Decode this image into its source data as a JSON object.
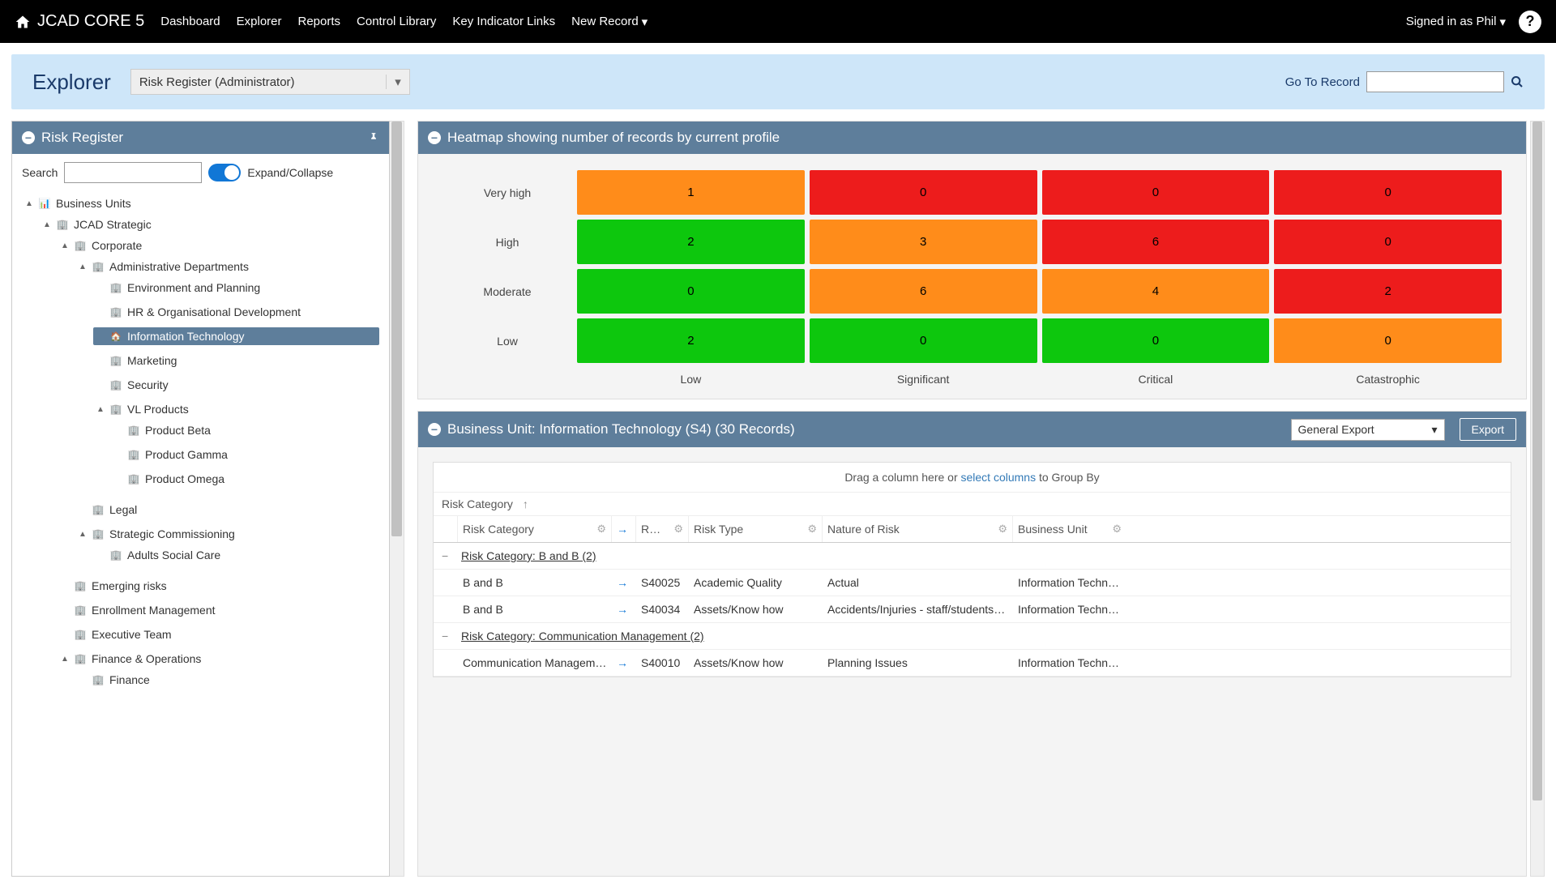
{
  "nav": {
    "brand": "JCAD CORE 5",
    "links": [
      "Dashboard",
      "Explorer",
      "Reports",
      "Control Library",
      "Key Indicator Links",
      "New Record"
    ],
    "signed_in": "Signed in as Phil"
  },
  "explorer_bar": {
    "title": "Explorer",
    "view_select": "Risk Register (Administrator)",
    "goto_label": "Go To Record"
  },
  "tree_panel": {
    "title": "Risk Register",
    "search_label": "Search",
    "expand_label": "Expand/Collapse",
    "tree": {
      "root": "Business Units",
      "l1": "JCAD Strategic",
      "l2": "Corporate",
      "l3": "Administrative Departments",
      "items_admin": [
        "Environment and Planning",
        "HR & Organisational Development",
        "Information Technology",
        "Marketing",
        "Security"
      ],
      "vl": "VL Products",
      "vl_items": [
        "Product Beta",
        "Product Gamma",
        "Product Omega"
      ],
      "corp_siblings_legal": "Legal",
      "strategic_comm": "Strategic Commissioning",
      "strategic_comm_items": [
        "Adults Social Care"
      ],
      "jcad_siblings": [
        "Emerging risks",
        "Enrollment Management",
        "Executive Team"
      ],
      "fin_ops": "Finance & Operations",
      "fin_ops_items": [
        "Finance"
      ]
    }
  },
  "heatmap": {
    "title": "Heatmap showing number of records by current profile",
    "row_labels": [
      "Very high",
      "High",
      "Moderate",
      "Low"
    ],
    "col_labels": [
      "Low",
      "Significant",
      "Critical",
      "Catastrophic"
    ]
  },
  "chart_data": {
    "type": "heatmap",
    "title": "Heatmap showing number of records by current profile",
    "y_categories": [
      "Very high",
      "High",
      "Moderate",
      "Low"
    ],
    "x_categories": [
      "Low",
      "Significant",
      "Critical",
      "Catastrophic"
    ],
    "values": [
      [
        1,
        0,
        0,
        0
      ],
      [
        2,
        3,
        6,
        0
      ],
      [
        0,
        6,
        4,
        2
      ],
      [
        2,
        0,
        0,
        0
      ]
    ],
    "colors": [
      [
        "orange",
        "red",
        "red",
        "red"
      ],
      [
        "green",
        "orange",
        "red",
        "red"
      ],
      [
        "green",
        "orange",
        "orange",
        "red"
      ],
      [
        "green",
        "green",
        "green",
        "orange"
      ]
    ]
  },
  "records": {
    "title": "Business Unit: Information Technology (S4) (30 Records)",
    "export_select": "General Export",
    "export_btn": "Export",
    "groupby_prefix": "Drag a column here or ",
    "groupby_link": "select columns",
    "groupby_suffix": " to Group By",
    "sort_col": "Risk Category",
    "columns": [
      "Risk Category",
      "R…",
      "Risk Type",
      "Nature of Risk",
      "Business Unit"
    ],
    "groups": [
      {
        "header": "Risk Category: B and B (2)",
        "rows": [
          {
            "cat": "B and B",
            "ref": "S40025",
            "type": "Academic Quality",
            "nature": "Actual",
            "bu": "Information Technology"
          },
          {
            "cat": "B and B",
            "ref": "S40034",
            "type": "Assets/Know how",
            "nature": "Accidents/Injuries - staff/students/others",
            "bu": "Information Technology"
          }
        ]
      },
      {
        "header": "Risk Category: Communication Management (2)",
        "rows": [
          {
            "cat": "Communication Management",
            "ref": "S40010",
            "type": "Assets/Know how",
            "nature": "Planning Issues",
            "bu": "Information Technology"
          }
        ]
      }
    ]
  }
}
